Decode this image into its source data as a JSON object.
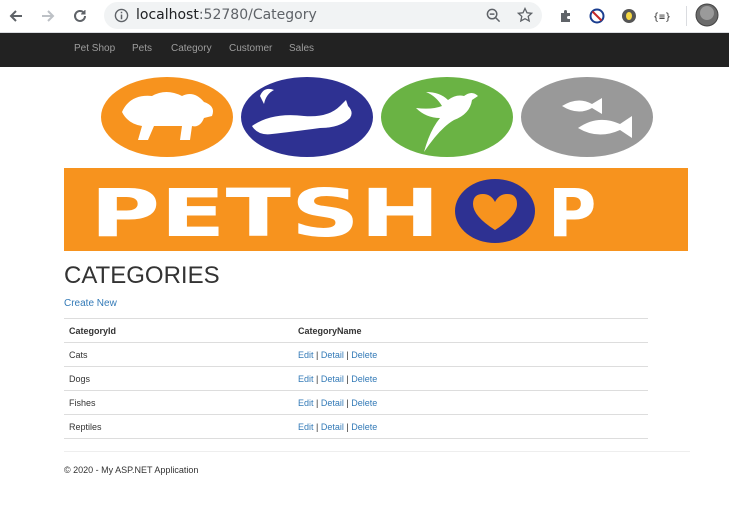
{
  "browser": {
    "url_host": "localhost",
    "url_path": ":52780/Category",
    "colors": {
      "toolbar_bg": "#ffffff",
      "omnibox_bg": "#f1f3f4"
    }
  },
  "navbar": {
    "items": [
      "Pet Shop",
      "Pets",
      "Category",
      "Customer",
      "Sales"
    ],
    "bg": "#222222",
    "text": "#9d9d9d"
  },
  "banner": {
    "logo_text": "PETSHOP",
    "circle_colors": [
      "#f7931e",
      "#2e3192",
      "#6ab344",
      "#999999"
    ],
    "band_color": "#f7931e"
  },
  "page": {
    "title": "CATEGORIES",
    "create_link": "Create New"
  },
  "table": {
    "headers": [
      "CategoryId",
      "CategoryName"
    ],
    "rows": [
      {
        "id": "Cats",
        "edit": "Edit",
        "detail": "Detail",
        "delete": "Delete"
      },
      {
        "id": "Dogs",
        "edit": "Edit",
        "detail": "Detail",
        "delete": "Delete"
      },
      {
        "id": "Fishes",
        "edit": "Edit",
        "detail": "Detail",
        "delete": "Delete"
      },
      {
        "id": "Reptiles",
        "edit": "Edit",
        "detail": "Detail",
        "delete": "Delete"
      }
    ],
    "separator": "|"
  },
  "footer": {
    "text": "© 2020 - My ASP.NET Application"
  },
  "colors": {
    "link": "#337ab7",
    "text": "#333333"
  }
}
